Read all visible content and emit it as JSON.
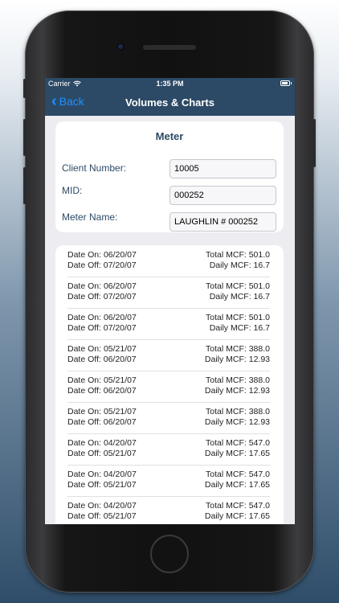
{
  "status_bar": {
    "carrier": "Carrier",
    "time": "1:35 PM"
  },
  "nav": {
    "back_label": "Back",
    "title": "Volumes & Charts"
  },
  "meter": {
    "title": "Meter",
    "client_number_label": "Client Number:",
    "client_number_value": "10005",
    "mid_label": "MID:",
    "mid_value": "000252",
    "meter_name_label": "Meter Name:",
    "meter_name_value": "LAUGHLIN # 000252"
  },
  "readings": [
    {
      "date_on": "Date On: 06/20/07",
      "date_off": "Date Off: 07/20/07",
      "total": "Total MCF: 501.0",
      "daily": "Daily MCF: 16.7"
    },
    {
      "date_on": "Date On: 06/20/07",
      "date_off": "Date Off: 07/20/07",
      "total": "Total MCF: 501.0",
      "daily": "Daily MCF: 16.7"
    },
    {
      "date_on": "Date On: 06/20/07",
      "date_off": "Date Off: 07/20/07",
      "total": "Total MCF: 501.0",
      "daily": "Daily MCF: 16.7"
    },
    {
      "date_on": "Date On: 05/21/07",
      "date_off": "Date Off: 06/20/07",
      "total": "Total MCF: 388.0",
      "daily": "Daily MCF: 12.93"
    },
    {
      "date_on": "Date On: 05/21/07",
      "date_off": "Date Off: 06/20/07",
      "total": "Total MCF: 388.0",
      "daily": "Daily MCF: 12.93"
    },
    {
      "date_on": "Date On: 05/21/07",
      "date_off": "Date Off: 06/20/07",
      "total": "Total MCF: 388.0",
      "daily": "Daily MCF: 12.93"
    },
    {
      "date_on": "Date On: 04/20/07",
      "date_off": "Date Off: 05/21/07",
      "total": "Total MCF: 547.0",
      "daily": "Daily MCF: 17.65"
    },
    {
      "date_on": "Date On: 04/20/07",
      "date_off": "Date Off: 05/21/07",
      "total": "Total MCF: 547.0",
      "daily": "Daily MCF: 17.65"
    },
    {
      "date_on": "Date On: 04/20/07",
      "date_off": "Date Off: 05/21/07",
      "total": "Total MCF: 547.0",
      "daily": "Daily MCF: 17.65"
    }
  ],
  "colors": {
    "nav_bg": "#2c4a66",
    "accent": "#1e90ff",
    "label": "#2c4a66"
  },
  "icons": {
    "back": "chevron-left-icon",
    "wifi": "wifi-icon",
    "battery": "battery-icon"
  }
}
